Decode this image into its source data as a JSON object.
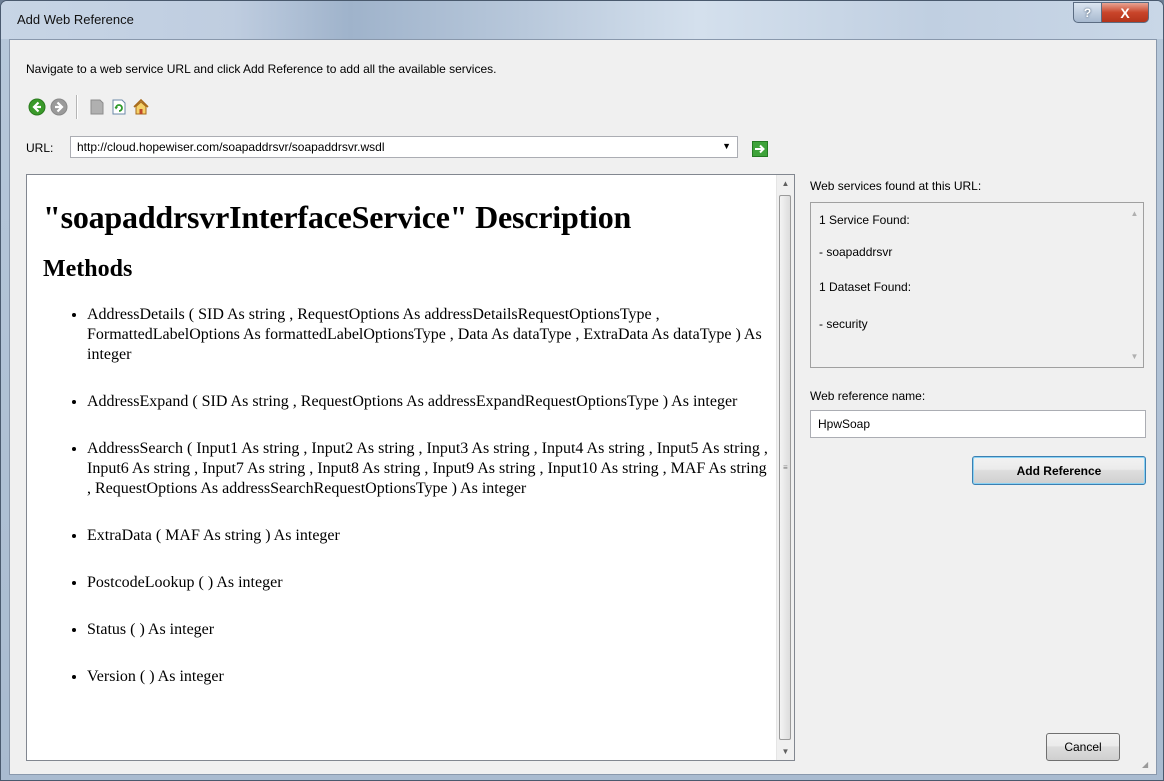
{
  "window": {
    "title": "Add Web Reference",
    "help_symbol": "?",
    "close_symbol": "X"
  },
  "instructions": "Navigate to a web service URL and click Add Reference to add all the available services.",
  "toolbar": {
    "items": [
      "back-icon",
      "forward-icon",
      "stop-icon",
      "refresh-icon",
      "home-icon"
    ]
  },
  "url": {
    "label": "URL:",
    "value": "http://cloud.hopewiser.com/soapaddrsvr/soapaddrsvr.wsdl"
  },
  "document": {
    "heading": "\"soapaddrsvrInterfaceService\" Description",
    "subheading": "Methods",
    "methods": [
      "AddressDetails ( SID As string ,  RequestOptions As addressDetailsRequestOptionsType ,  FormattedLabelOptions As formattedLabelOptionsType ,  Data As dataType ,  ExtraData As dataType ) As integer",
      "AddressExpand ( SID As string ,  RequestOptions As addressExpandRequestOptionsType ) As integer",
      "AddressSearch ( Input1 As string ,  Input2 As string ,  Input3 As string ,  Input4 As string ,  Input5 As string ,  Input6 As string ,  Input7 As string ,  Input8 As string ,  Input9 As string ,  Input10 As string ,  MAF As string ,  RequestOptions As addressSearchRequestOptionsType ) As integer",
      "ExtraData ( MAF As string ) As integer",
      "PostcodeLookup ( ) As integer",
      "Status ( ) As integer",
      "Version ( ) As integer"
    ]
  },
  "services": {
    "label": "Web services found at this URL:",
    "lines": [
      "1 Service Found:",
      "- soapaddrsvr",
      "1 Dataset Found:",
      "- security"
    ]
  },
  "reference_name": {
    "label": "Web reference name:",
    "value": "HpwSoap"
  },
  "buttons": {
    "add_reference": "Add Reference",
    "cancel": "Cancel"
  }
}
